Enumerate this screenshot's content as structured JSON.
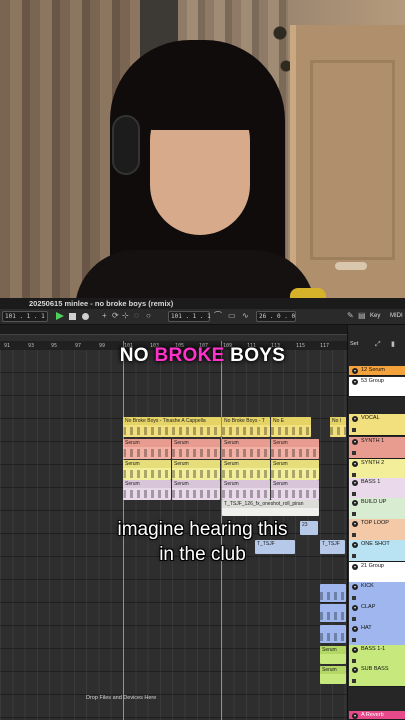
{
  "window": {
    "song_title": "20250615 minlee - no broke boys (remix)"
  },
  "transport": {
    "position": "101 .   1 .   1",
    "loop_start": "101 .   1 .   1",
    "loop_length": "26 .   0 .   0",
    "key_label": "Key",
    "midi_label": "MIDI"
  },
  "ruler": {
    "bars": [
      "91",
      "93",
      "95",
      "97",
      "99",
      "101",
      "103",
      "105",
      "107",
      "109",
      "111",
      "113",
      "115",
      "117"
    ]
  },
  "overlay": {
    "title_part1": "NO ",
    "title_highlight": "BROKE",
    "title_part2": " BOYS",
    "subtitle_line1": "imagine hearing this",
    "subtitle_line2": "in the club",
    "highlight_color": "#ff33cc"
  },
  "arrangement": {
    "set_label": "Set",
    "drop_hint": "Drop Files and Devices Here",
    "clips": {
      "vocal": [
        "No Broke Boys - Tinashe A Cappella",
        "No Broke Boys - T",
        "No E",
        "No I"
      ],
      "synth_label": "Serum",
      "fx_clip": "T_TSJF_126_fx_oneshot_roll_piran",
      "short_fx": "T_TSJF",
      "bar_23": "23"
    }
  },
  "tracks": [
    {
      "name": "12 Serum",
      "color": "#f4a23c"
    },
    {
      "name": "53 Group",
      "color": "#ffffff"
    },
    {
      "name": "VOCAL",
      "color": "#f1e07d"
    },
    {
      "name": "SYNTH 1",
      "color": "#e89c90"
    },
    {
      "name": "SYNTH 2",
      "color": "#f3ee9a"
    },
    {
      "name": "BASS 1",
      "color": "#e9d9ea"
    },
    {
      "name": "BUILD UP",
      "color": "#d7ecd0"
    },
    {
      "name": "TOP LOOP",
      "color": "#f3c9a8"
    },
    {
      "name": "ONE SHOT",
      "color": "#b9e3f3"
    },
    {
      "name": "21 Group",
      "color": "#ffffff"
    },
    {
      "name": "KICK",
      "color": "#9fb7ee"
    },
    {
      "name": "CLAP",
      "color": "#9fb7ee"
    },
    {
      "name": "HAT",
      "color": "#9fb7ee"
    },
    {
      "name": "BASS 1-1",
      "color": "#c7e87c"
    },
    {
      "name": "SUB BASS",
      "color": "#c7e87c"
    },
    {
      "name": "A Reverb",
      "color": "#e64a8a"
    }
  ]
}
